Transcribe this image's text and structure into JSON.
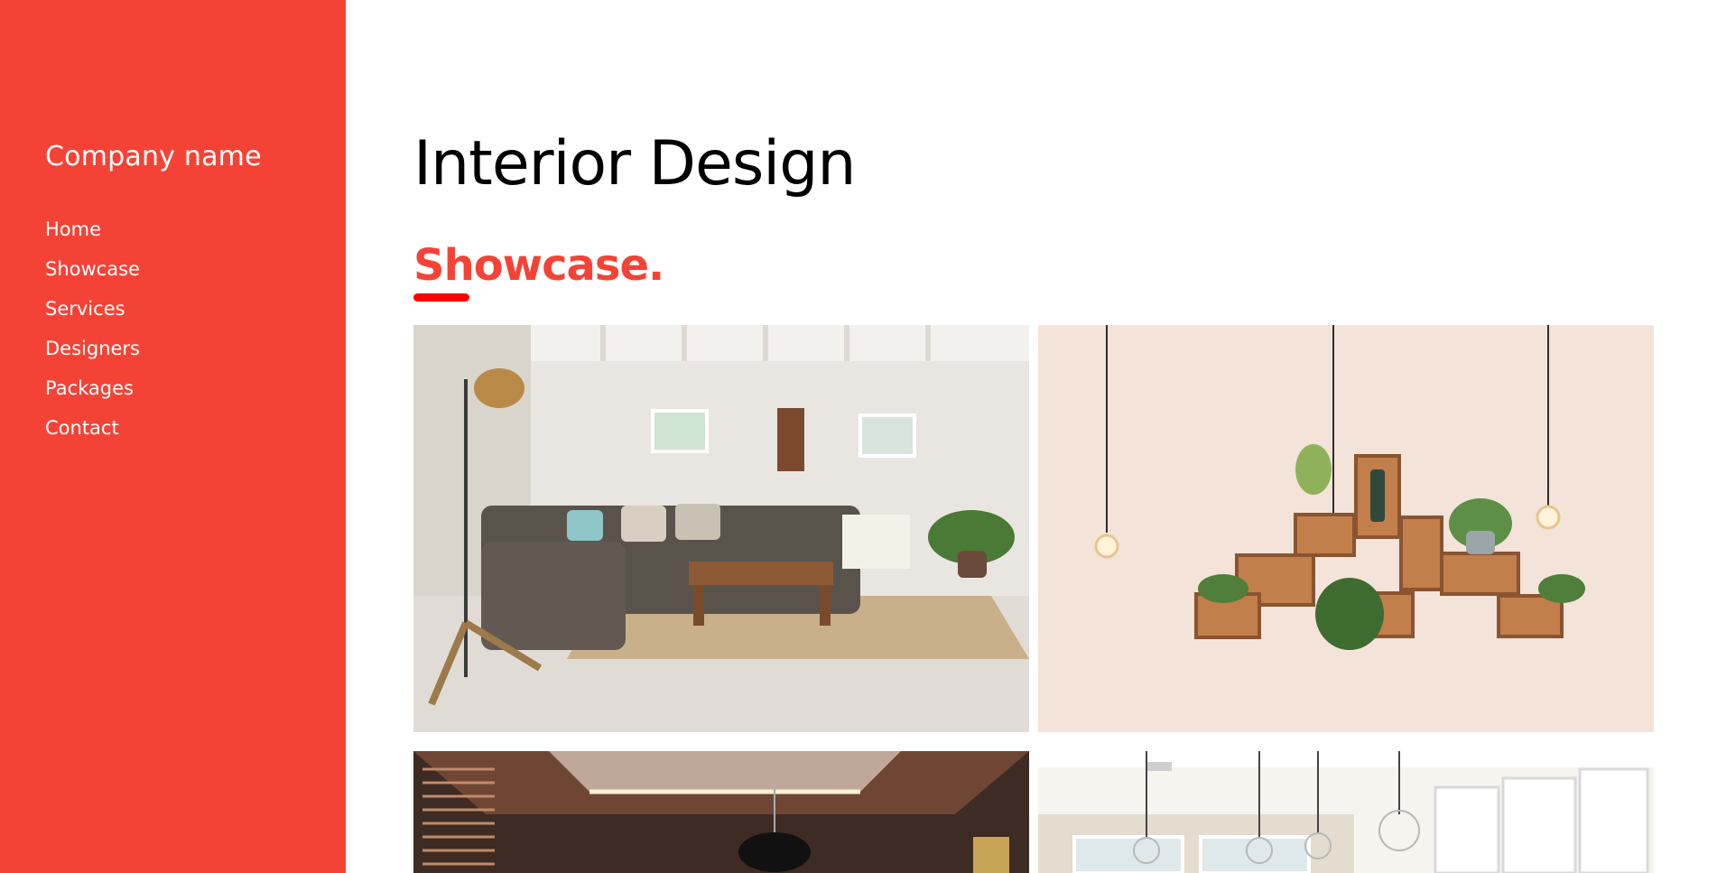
{
  "sidebar": {
    "company_name": "Company name",
    "nav": [
      "Home",
      "Showcase",
      "Services",
      "Designers",
      "Packages",
      "Contact"
    ]
  },
  "main": {
    "title": "Interior Design",
    "section_heading": "Showcase."
  },
  "colors": {
    "accent": "#f44336",
    "underline": "#ff0000"
  }
}
